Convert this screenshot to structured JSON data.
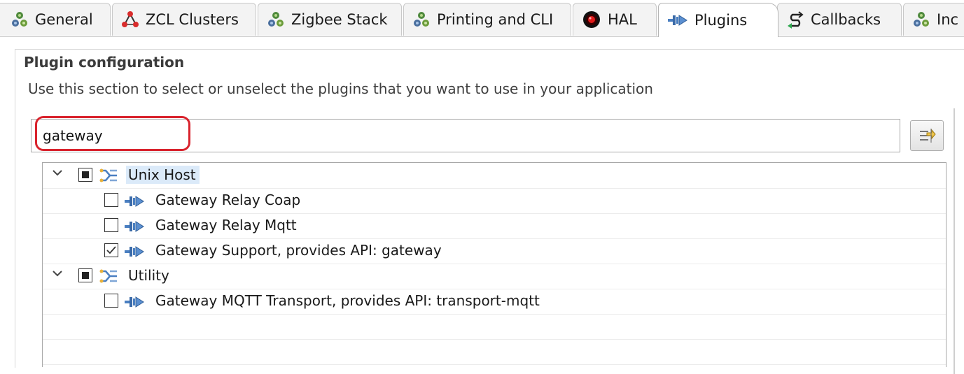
{
  "tabs": [
    {
      "label": "General",
      "icon": "cluster-icon"
    },
    {
      "label": "ZCL Clusters",
      "icon": "zcl-network-icon"
    },
    {
      "label": "Zigbee Stack",
      "icon": "cluster-icon"
    },
    {
      "label": "Printing and CLI",
      "icon": "cluster-icon"
    },
    {
      "label": "HAL",
      "icon": "hal-record-icon"
    },
    {
      "label": "Plugins",
      "icon": "plugin-icon",
      "active": true
    },
    {
      "label": "Callbacks",
      "icon": "callback-icon"
    },
    {
      "label": "Inc",
      "icon": "cluster-icon"
    }
  ],
  "section": {
    "title": "Plugin configuration",
    "description": "Use this section to select or unselect the plugins that you want to use in your application"
  },
  "filter": {
    "value": "gateway"
  },
  "tree": {
    "groups": [
      {
        "label": "Unix Host",
        "state": "partial",
        "expanded": true,
        "items": [
          {
            "label": "Gateway Relay Coap",
            "checked": false
          },
          {
            "label": "Gateway Relay Mqtt",
            "checked": false
          },
          {
            "label": "Gateway Support, provides API: gateway",
            "checked": true
          }
        ]
      },
      {
        "label": "Utility",
        "state": "partial",
        "expanded": true,
        "items": [
          {
            "label": "Gateway MQTT Transport, provides API: transport-mqtt",
            "checked": false
          }
        ]
      }
    ]
  },
  "colors": {
    "highlight": "#d9232d",
    "selection": "#dbeaf9",
    "plugin_icon": "#4a7fc1",
    "cluster_green": "#5b8c3a"
  }
}
